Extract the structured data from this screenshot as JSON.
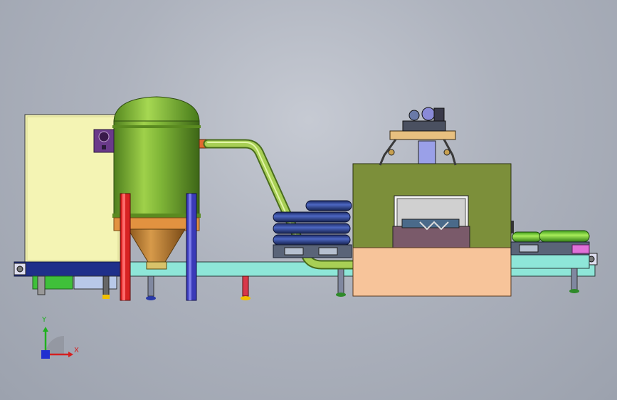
{
  "viewport": {
    "background": "#adb2bd"
  },
  "triad": {
    "x_label": "X",
    "y_label": "Y",
    "x_color": "#d42020",
    "y_color": "#20b020",
    "z_color": "#2030d0"
  },
  "colors": {
    "tank": "#6aa52e",
    "tank_cone": "#b5792f",
    "pipe": "#9cc24a",
    "panel": "#f4f4b4",
    "conveyor": "#8ee6d8",
    "press_body": "#7c8f3a",
    "press_base": "#f7c49a",
    "bottles": "#2a3f8c",
    "red_leg": "#d82222",
    "blue_leg": "#3a3ab8"
  }
}
